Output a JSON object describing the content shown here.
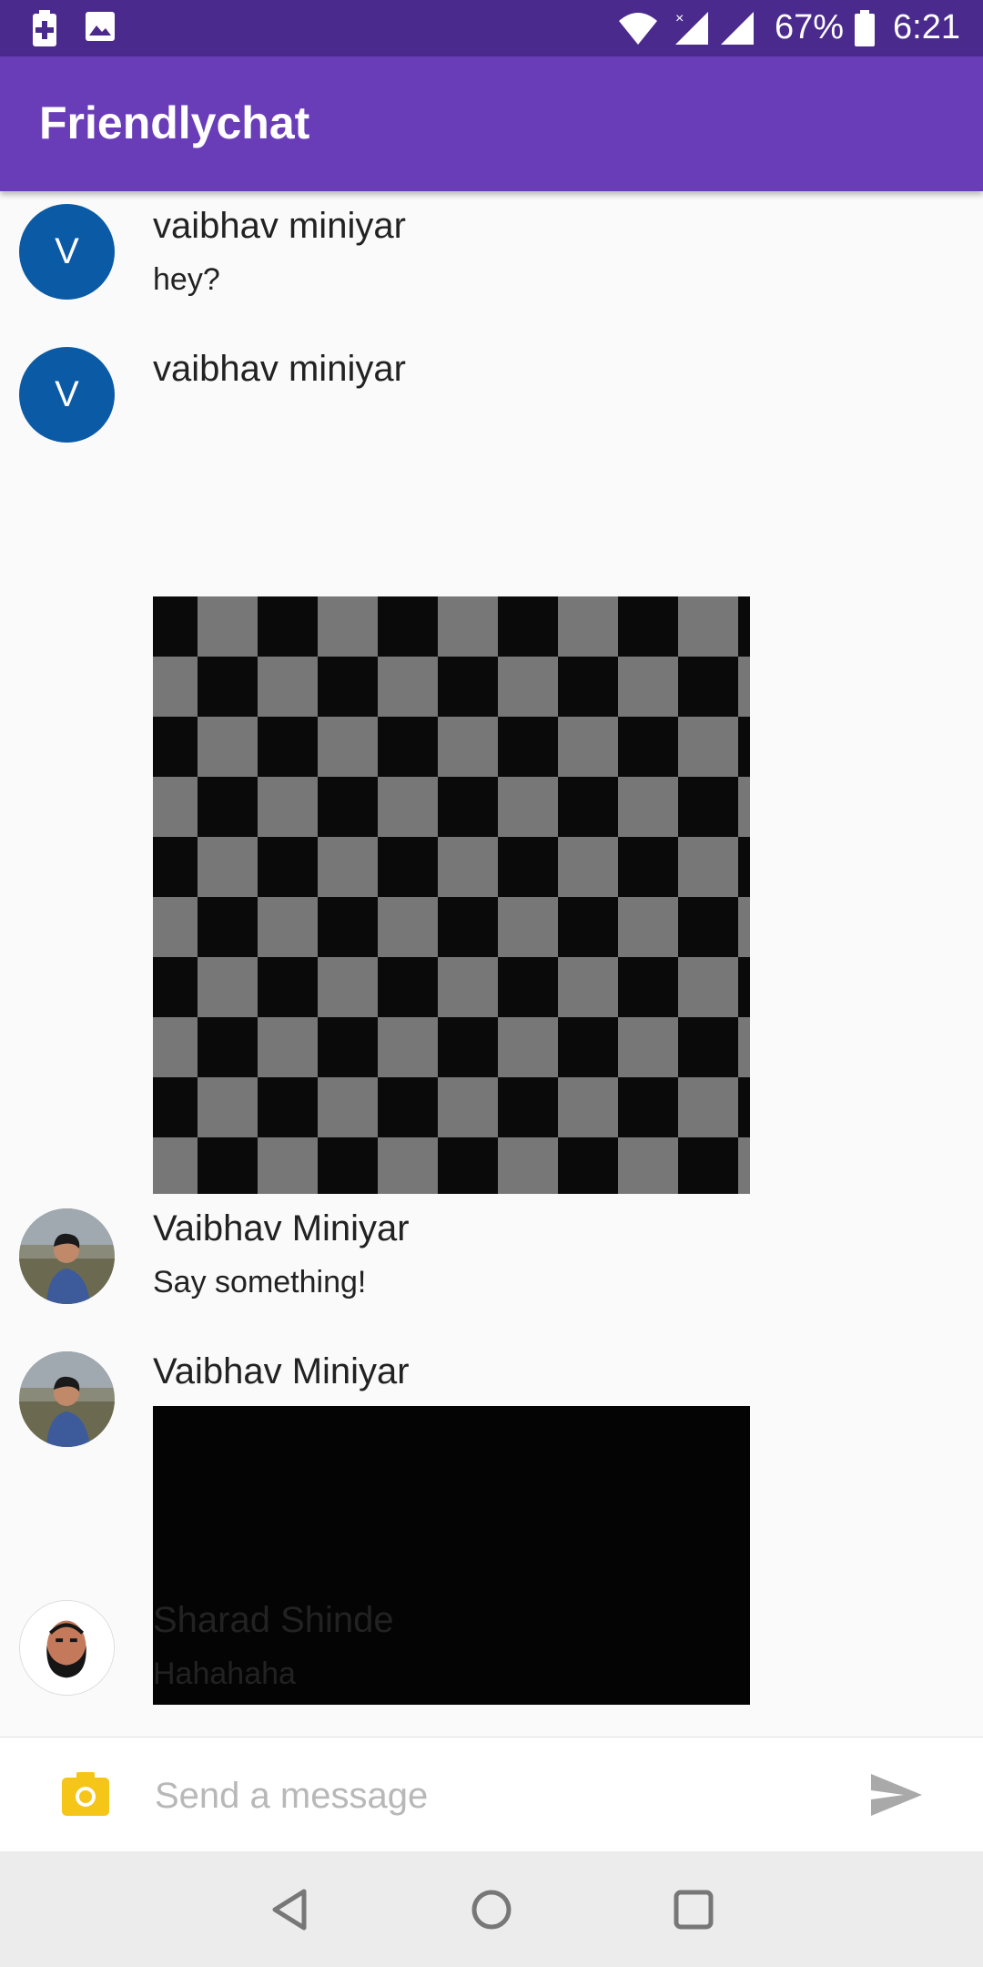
{
  "status_bar": {
    "battery_percent": "67%",
    "time": "6:21",
    "icons": [
      "battery-saver-icon",
      "image-icon",
      "wifi-icon",
      "signal-no-data-icon",
      "signal-icon",
      "battery-icon"
    ]
  },
  "app_bar": {
    "title": "Friendlychat"
  },
  "messages": [
    {
      "author": "vaibhav miniyar",
      "avatar": "V",
      "text": "hey?"
    },
    {
      "author": "vaibhav miniyar",
      "avatar": "V",
      "image": "checkerboard-image"
    },
    {
      "author": "Vaibhav Miniyar",
      "avatar": "profile-photo",
      "text": "Say something!"
    },
    {
      "author": "Vaibhav Miniyar",
      "avatar": "profile-photo",
      "image": "black-image"
    },
    {
      "author": "Sharad Shinde",
      "avatar": "cartoon-face",
      "text": "Hahahaha"
    }
  ],
  "composer": {
    "placeholder": "Send a message",
    "camera_icon": "camera-icon",
    "send_icon": "send-icon"
  },
  "nav_bar": {
    "icons": [
      "back-icon",
      "home-icon",
      "recents-icon"
    ]
  },
  "colors": {
    "status_bar": "#4a2a8c",
    "app_bar": "#6a3db8",
    "avatar_blue": "#0b5aa6",
    "camera": "#f5c518"
  }
}
